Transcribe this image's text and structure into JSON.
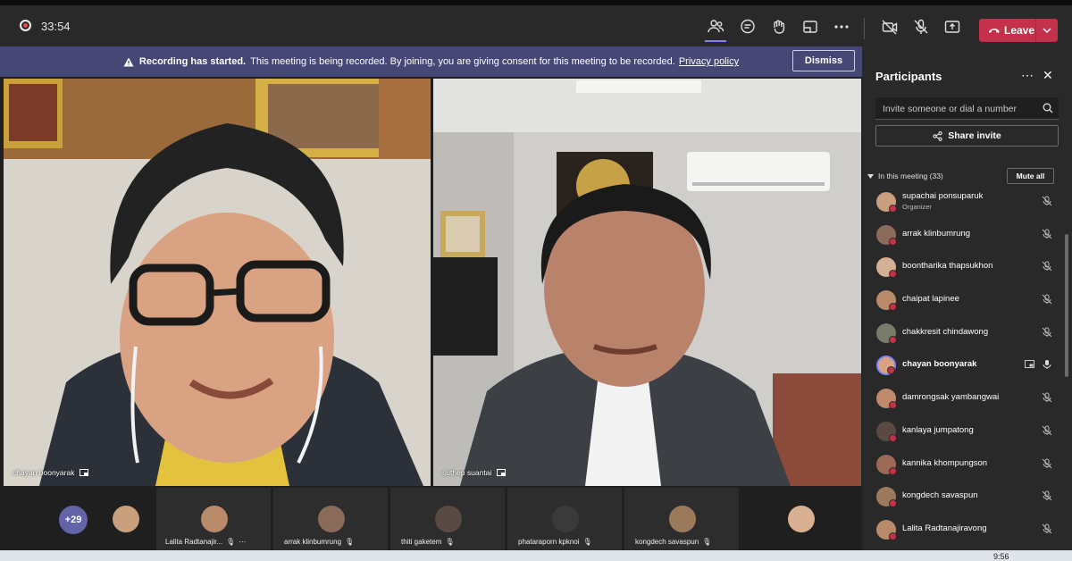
{
  "call": {
    "timer": "33:54"
  },
  "toolbar": {
    "icons": [
      "participants-icon",
      "chat-icon",
      "reactions-icon",
      "rooms-icon",
      "more-icon",
      "camera-off-icon",
      "mic-off-icon",
      "share-icon"
    ],
    "leave_label": "Leave"
  },
  "banner": {
    "title": "Recording has started.",
    "message": "This meeting is being recorded. By joining, you are giving consent for this meeting to be recorded.",
    "link": "Privacy policy",
    "dismiss_label": "Dismiss"
  },
  "tiles": [
    {
      "name": "chayan boonyarak"
    },
    {
      "name": "suthep suantai"
    }
  ],
  "strip": {
    "overflow": "+29",
    "thumbs": [
      {
        "name": ""
      },
      {
        "name": "Lalita Radtanajir..."
      },
      {
        "name": "arrak klinbumrung"
      },
      {
        "name": "thiti gaketem"
      },
      {
        "name": "phataraporn kpknoi"
      },
      {
        "name": "kongdech savaspun"
      },
      {
        "name": ""
      }
    ]
  },
  "panel": {
    "title": "Participants",
    "invite_placeholder": "Invite someone or dial a number",
    "share_label": "Share invite",
    "section_label": "In this meeting (33)",
    "mute_all_label": "Mute all",
    "participants": [
      {
        "name": "supachai ponsuparuk",
        "role": "Organizer",
        "muted": true
      },
      {
        "name": "arrak klinbumrung",
        "role": "",
        "muted": true
      },
      {
        "name": "boontharika thapsukhon",
        "role": "",
        "muted": true
      },
      {
        "name": "chaipat lapinee",
        "role": "",
        "muted": true
      },
      {
        "name": "chakkresit chindawong",
        "role": "",
        "muted": true
      },
      {
        "name": "chayan boonyarak",
        "role": "",
        "muted": false
      },
      {
        "name": "damrongsak yambangwai",
        "role": "",
        "muted": true
      },
      {
        "name": "kanlaya jumpatong",
        "role": "",
        "muted": true
      },
      {
        "name": "kannika khompungson",
        "role": "",
        "muted": true
      },
      {
        "name": "kongdech savaspun",
        "role": "",
        "muted": true
      },
      {
        "name": "Lalita Radtanajiravong",
        "role": "",
        "muted": true
      }
    ]
  },
  "taskbar": {
    "clock": "9:56"
  },
  "colors": {
    "accent": "#6264a7",
    "leave": "#c4314b",
    "banner": "#464775"
  }
}
